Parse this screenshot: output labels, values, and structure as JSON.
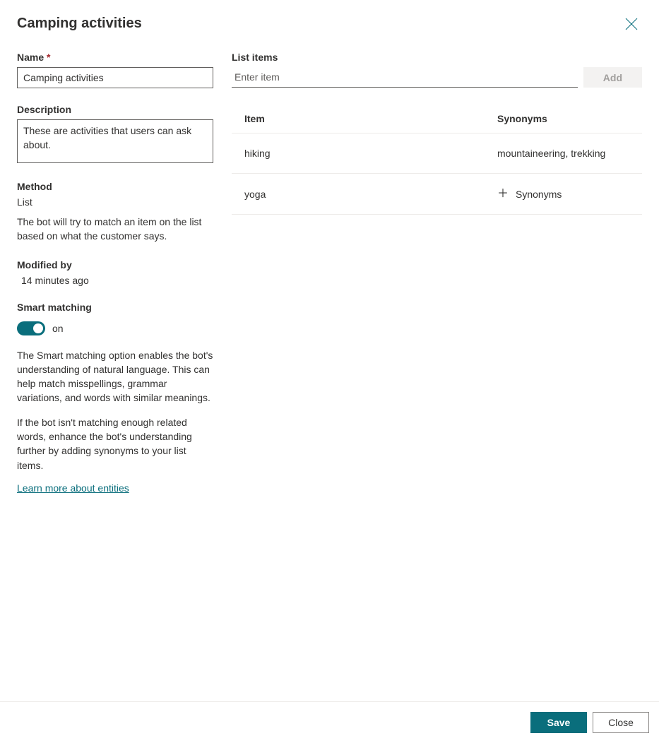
{
  "header": {
    "title": "Camping activities"
  },
  "form": {
    "name_label": "Name",
    "name_value": "Camping activities",
    "description_label": "Description",
    "description_value": "These are activities that users can ask about.",
    "method_label": "Method",
    "method_value": "List",
    "method_help": "The bot will try to match an item on the list based on what the customer says.",
    "modified_label": "Modified by",
    "modified_value": "14 minutes ago",
    "smart_label": "Smart matching",
    "smart_state": "on",
    "smart_desc1": "The Smart matching option enables the bot's understanding of natural language. This can help match misspellings, grammar variations, and words with similar meanings.",
    "smart_desc2": "If the bot isn't matching enough related words, enhance the bot's understanding further by adding synonyms to your list items.",
    "learn_link": "Learn more about entities"
  },
  "list": {
    "label": "List items",
    "placeholder": "Enter item",
    "add_button": "Add",
    "col_item": "Item",
    "col_syn": "Synonyms",
    "syn_add_label": "Synonyms",
    "items": [
      {
        "item": "hiking",
        "synonyms": "mountaineering, trekking"
      },
      {
        "item": "yoga",
        "synonyms": ""
      }
    ]
  },
  "footer": {
    "save": "Save",
    "close": "Close"
  }
}
